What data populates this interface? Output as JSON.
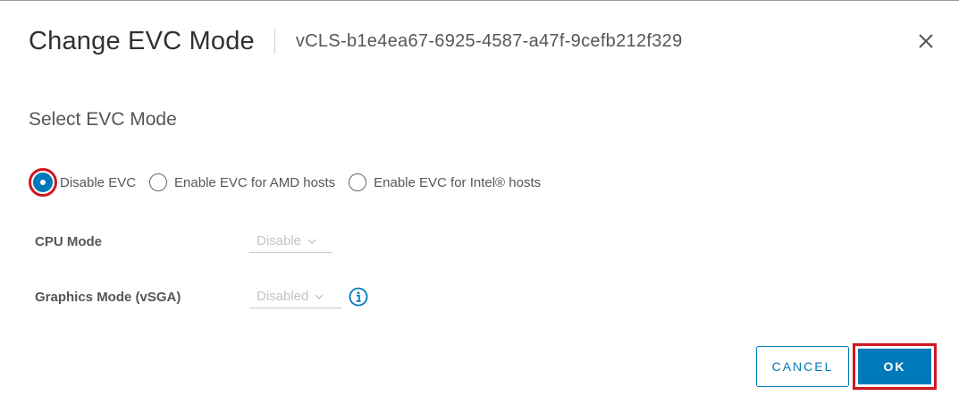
{
  "dialog": {
    "title": "Change EVC Mode",
    "subtitle": "vCLS-b1e4ea67-6925-4587-a47f-9cefb212f329",
    "close_icon": "close-icon"
  },
  "section": {
    "title": "Select EVC Mode"
  },
  "evc_options": [
    {
      "label": "Disable EVC",
      "selected": true
    },
    {
      "label": "Enable EVC for AMD hosts",
      "selected": false
    },
    {
      "label": "Enable EVC for Intel® hosts",
      "selected": false
    }
  ],
  "cpu_mode": {
    "label": "CPU Mode",
    "value": "Disable"
  },
  "graphics_mode": {
    "label": "Graphics Mode (vSGA)",
    "value": "Disabled",
    "info_icon": "info-icon"
  },
  "buttons": {
    "cancel": "CANCEL",
    "ok": "OK"
  },
  "colors": {
    "accent": "#0079b8",
    "highlight": "#d0161f"
  }
}
